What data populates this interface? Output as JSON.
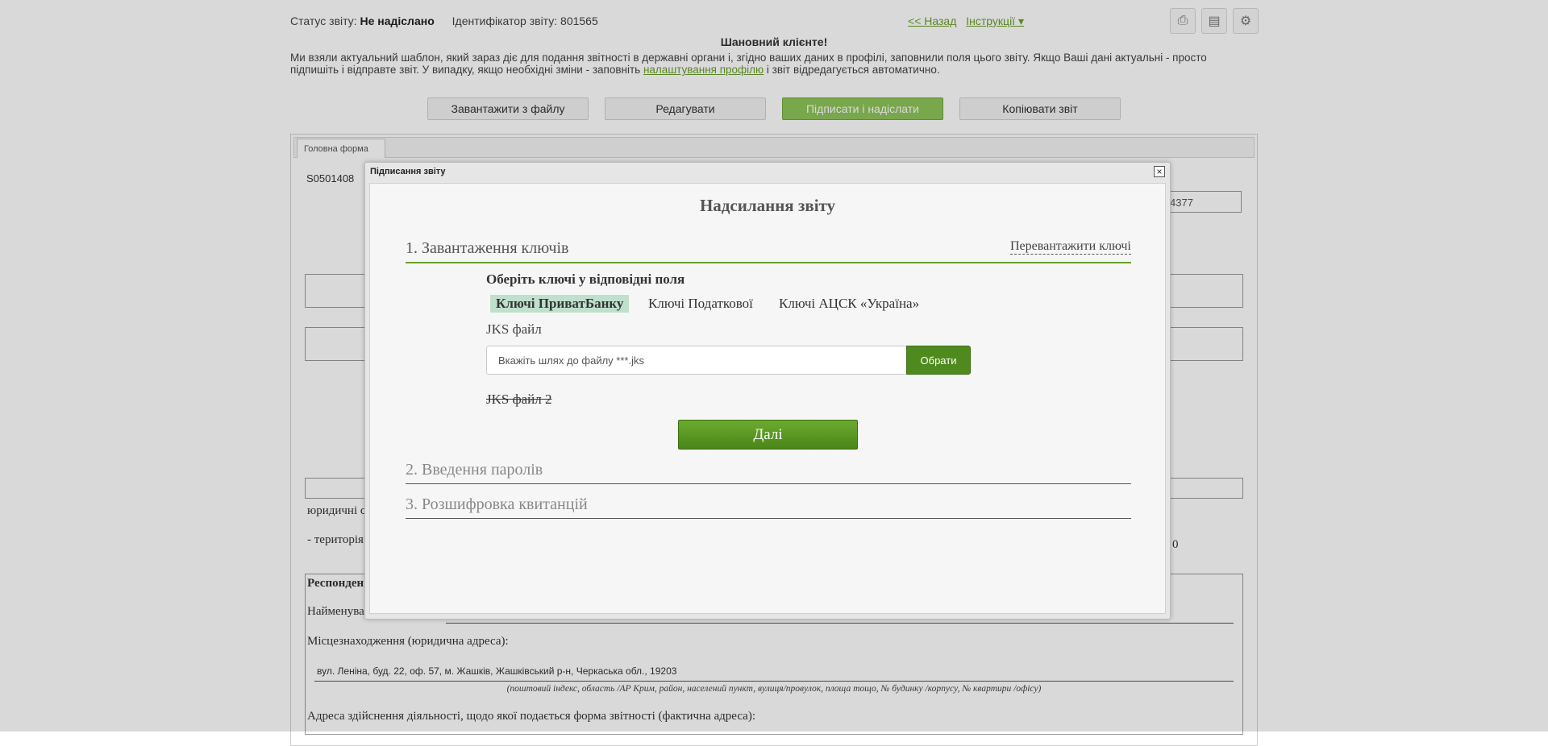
{
  "header": {
    "status_label": "Статус звіту:",
    "status_value": "Не надіслано",
    "id_label": "Ідентифікатор звіту:",
    "id_value": "801565",
    "back_link": "<< Назад",
    "instructions_link": "Інструкції ▾"
  },
  "greeting": "Шановний клієнте!",
  "notice": {
    "text_before": "Ми взяли актуальний шаблон, який зараз діє для подання звітності в державні органи і, згідно ваших даних в профілі, заповнили поля цього звіту. Якщо Ваші дані актуальні - просто підпишіть і відправте звіт. У випадку, якщо необхідні зміни - заповніть ",
    "link": "налаштування профілю",
    "text_after": " і звіт відредагується автоматично."
  },
  "actions": {
    "upload": "Завантажити з файлу",
    "edit": "Редагувати",
    "sign_send": "Підписати і надіслати",
    "copy": "Копіювати звіт"
  },
  "form": {
    "tab": "Головна форма",
    "code": "S0501408",
    "field_tail": "4377",
    "row1": "юридичні с",
    "row2": "- територія",
    "row2_tail": "0",
    "respondent": "Респонден",
    "name_label": "Найменува",
    "location_label": "Місцезнаходження (юридична адреса):",
    "address_value": "вул. Леніна, буд. 22, оф. 57, м. Жашків, Жашківський р-н, Черкаська обл., 19203",
    "address_hint": "(поштовий індекс, область /АР Крим, район, населений пункт, вулиця/провулок, площа тощо, № будинку /корпусу, № квартири /офісу)",
    "activity_address_label": "Адреса здійснення діяльності, щодо якої подається форма звітності (фактична адреса):"
  },
  "modal": {
    "title": "Підписання звіту",
    "heading": "Надсилання звіту",
    "step1": "1. Завантаження ключів",
    "reload_keys": "Перевантажити ключі",
    "choose_keys": "Оберіть ключі у відповідні поля",
    "key_tabs": [
      "Ключі ПриватБанку",
      "Ключі Податкової",
      "Ключі АЦСК «Україна»"
    ],
    "jks_label": "JKS файл",
    "file_placeholder": "Вкажіть шлях до файлу ***.jks",
    "choose_button": "Обрати",
    "jks2_label": "JKS файл 2",
    "next_button": "Далі",
    "step2": "2. Введення паролів",
    "step3": "3. Розшифровка квитанцій"
  },
  "colors": {
    "accent_green": "#4e8a1e",
    "link_green": "#6a9f2a",
    "active_tab_bg": "#bfe0cc"
  },
  "icons": [
    "print-icon",
    "pdf-icon",
    "settings-icon",
    "close-icon"
  ]
}
